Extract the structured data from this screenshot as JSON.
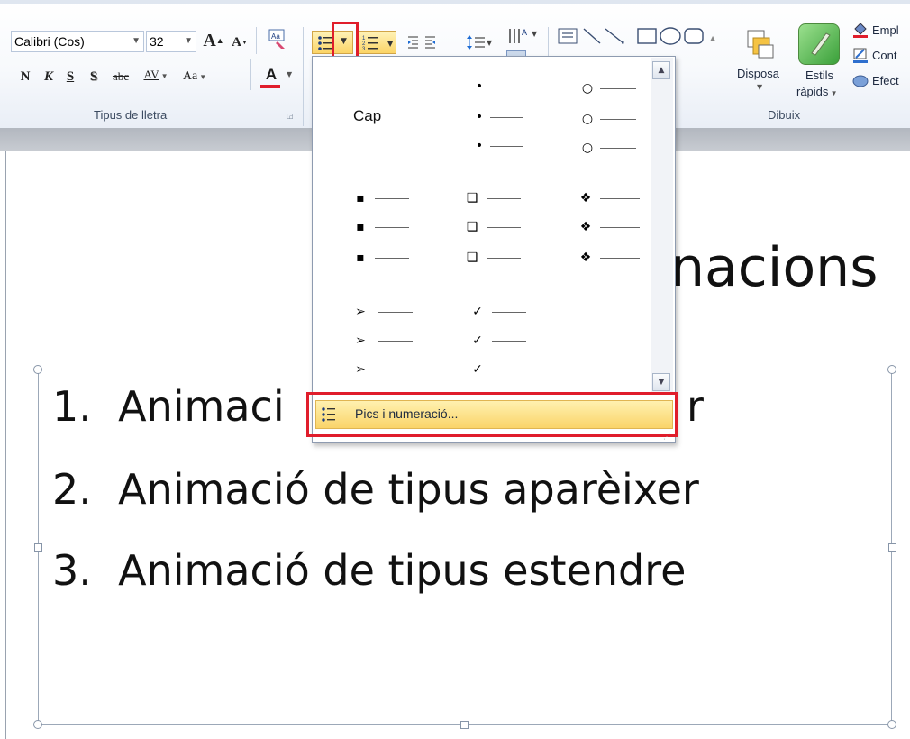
{
  "ribbon": {
    "font_group": {
      "font_name": "Calibri (Cos)",
      "font_size": "32",
      "grow_label": "A",
      "shrink_label": "A",
      "bold": "N",
      "italic": "K",
      "underline": "S",
      "shadow": "S",
      "strike": "abc",
      "spacing": "AV",
      "case": "Aa",
      "color_label": "A",
      "label": "Tipus de lletra"
    },
    "drawing_group": {
      "arrange_label": "Disposa",
      "quick_styles_line1": "Estils",
      "quick_styles_line2": "ràpids",
      "fill_label": "Empl",
      "outline_label": "Cont",
      "effects_label": "Efect",
      "label": "Dibuix"
    },
    "colors": {
      "accent_red": "#e01d2b",
      "highlight": "#fbd466"
    }
  },
  "slide": {
    "title_partial": "nacions",
    "list": [
      {
        "num": "1.",
        "text": "Animaci"
      },
      {
        "num": "2.",
        "text": "Animació de tipus aparèixer"
      },
      {
        "num": "3.",
        "text": "Animació de tipus estendre"
      }
    ],
    "list_item_1_tail": "r"
  },
  "bullet_dropdown": {
    "none_label": "Cap",
    "symbols": {
      "dot": "•",
      "circle": "○",
      "square": "▪",
      "box": "❑",
      "diamond": "❖",
      "arrow": "➢",
      "check": "✓"
    },
    "menu_item_label": "Pics i numeració..."
  }
}
